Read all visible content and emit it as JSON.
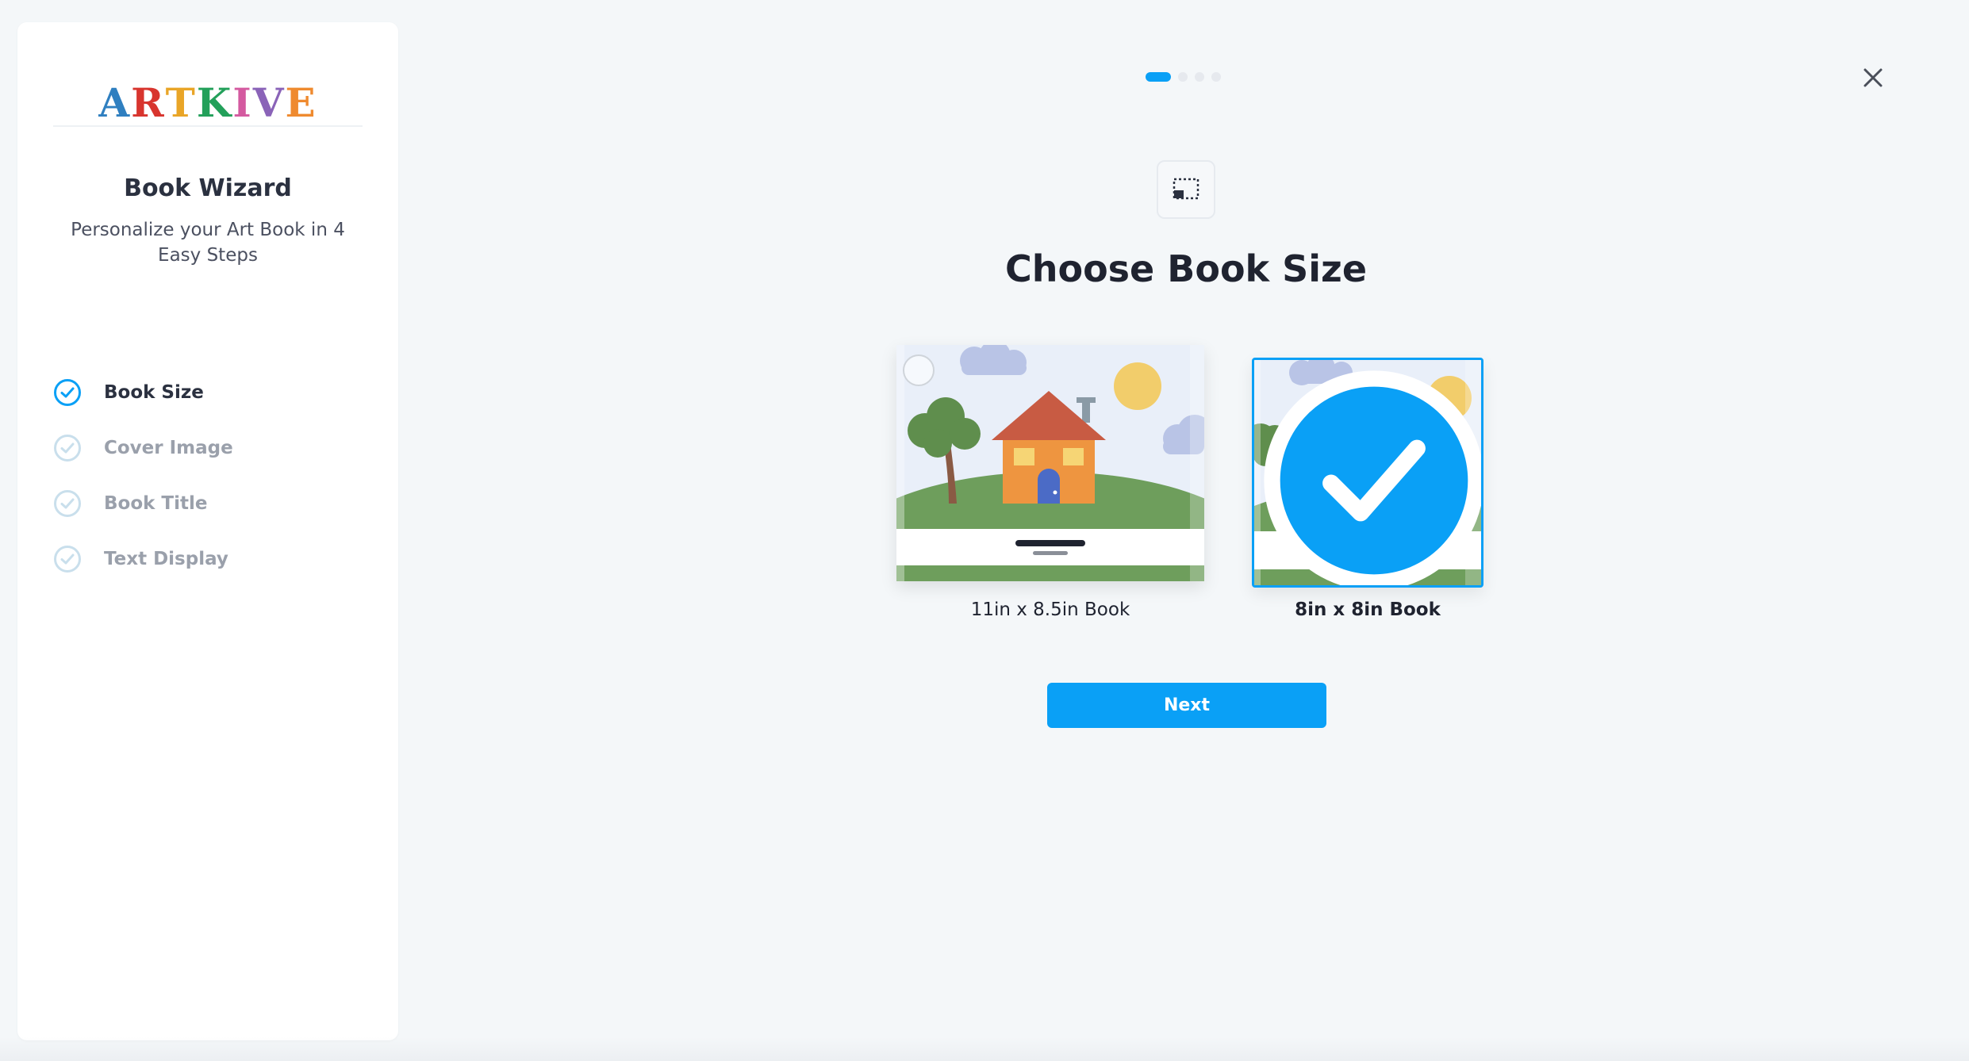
{
  "sidebar": {
    "logo_letters": [
      "A",
      "R",
      "T",
      "K",
      "I",
      "V",
      "E"
    ],
    "logo_colors": [
      "#2f7fc0",
      "#d8352e",
      "#e9a527",
      "#23a05a",
      "#d45aa0",
      "#8a63b8",
      "#ef8a2f"
    ],
    "title": "Book Wizard",
    "subtitle": "Personalize your Art Book in 4 Easy Steps",
    "steps": [
      {
        "label": "Book Size",
        "state": "active"
      },
      {
        "label": "Cover Image",
        "state": "inactive"
      },
      {
        "label": "Book Title",
        "state": "inactive"
      },
      {
        "label": "Text Display",
        "state": "inactive"
      }
    ]
  },
  "progress": {
    "current_step": 1,
    "total_steps": 4
  },
  "main": {
    "title": "Choose Book Size",
    "options": [
      {
        "label": "11in x 8.5in Book",
        "selected": false
      },
      {
        "label": "8in x 8in Book",
        "selected": true
      }
    ],
    "next_label": "Next"
  },
  "colors": {
    "accent": "#0aa0f6",
    "inactive_check": "#c9dfec",
    "page_bg": "#f4f7f9"
  },
  "icons": {
    "close": "close-icon",
    "book_size": "book-size-icon",
    "step_check": "check-circle-icon"
  }
}
